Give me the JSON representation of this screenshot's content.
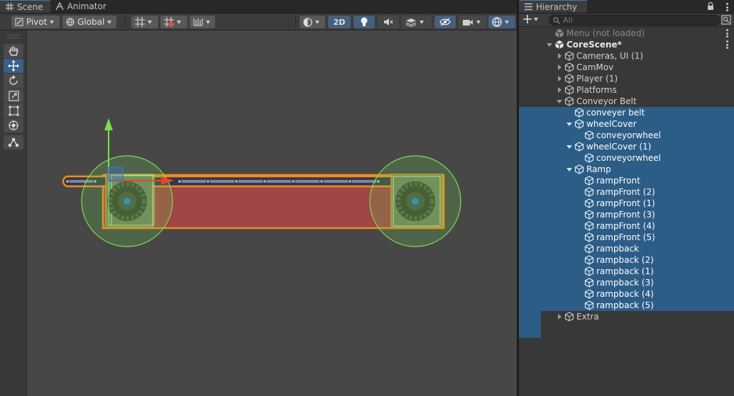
{
  "scene_tabs": [
    {
      "label": "Scene",
      "icon": "grid-icon",
      "active": true
    },
    {
      "label": "Animator",
      "icon": "animator-icon",
      "active": false
    }
  ],
  "scene_toolbar": {
    "pivot_label": "Pivot",
    "global_label": "Global",
    "mode_2d_label": "2D"
  },
  "tools": [
    "hand-tool",
    "move-tool",
    "rotate-tool",
    "scale-tool",
    "rect-tool",
    "transform-tool",
    "custom-editor-tool"
  ],
  "hierarchy": {
    "tab_label": "Hierarchy",
    "search_placeholder": "All",
    "rows": [
      {
        "label": "Menu (not loaded)",
        "depth": 0,
        "arrow": "none",
        "icon": "unity-scene-icon",
        "selected": false,
        "style": "dim"
      },
      {
        "label": "CoreScene*",
        "depth": 0,
        "arrow": "down",
        "icon": "unity-scene-icon",
        "selected": false,
        "style": "bold"
      },
      {
        "label": "Cameras, UI (1)",
        "depth": 1,
        "arrow": "right",
        "icon": "cube-icon",
        "selected": false
      },
      {
        "label": "CamMov",
        "depth": 1,
        "arrow": "right",
        "icon": "cube-icon",
        "selected": false
      },
      {
        "label": "Player (1)",
        "depth": 1,
        "arrow": "right",
        "icon": "cube-icon",
        "selected": false
      },
      {
        "label": "Platforms",
        "depth": 1,
        "arrow": "right",
        "icon": "cube-icon",
        "selected": false
      },
      {
        "label": "Conveyor Belt",
        "depth": 1,
        "arrow": "down",
        "icon": "cube-icon",
        "selected": false
      },
      {
        "label": "conveyer belt",
        "depth": 2,
        "arrow": "none",
        "icon": "cube-icon",
        "selected": true
      },
      {
        "label": "wheelCover",
        "depth": 2,
        "arrow": "down",
        "icon": "cube-icon",
        "selected": true
      },
      {
        "label": "conveyorwheel",
        "depth": 3,
        "arrow": "none",
        "icon": "cube-icon",
        "selected": true
      },
      {
        "label": "wheelCover (1)",
        "depth": 2,
        "arrow": "down",
        "icon": "cube-icon",
        "selected": true
      },
      {
        "label": "conveyorwheel",
        "depth": 3,
        "arrow": "none",
        "icon": "cube-icon",
        "selected": true
      },
      {
        "label": "Ramp",
        "depth": 2,
        "arrow": "down",
        "icon": "cube-icon",
        "selected": true
      },
      {
        "label": "rampFront",
        "depth": 3,
        "arrow": "none",
        "icon": "cube-icon",
        "selected": true
      },
      {
        "label": "rampFront (2)",
        "depth": 3,
        "arrow": "none",
        "icon": "cube-icon",
        "selected": true
      },
      {
        "label": "rampFront (1)",
        "depth": 3,
        "arrow": "none",
        "icon": "cube-icon",
        "selected": true
      },
      {
        "label": "rampFront (3)",
        "depth": 3,
        "arrow": "none",
        "icon": "cube-icon",
        "selected": true
      },
      {
        "label": "rampFront (4)",
        "depth": 3,
        "arrow": "none",
        "icon": "cube-icon",
        "selected": true
      },
      {
        "label": "rampFront (5)",
        "depth": 3,
        "arrow": "none",
        "icon": "cube-icon",
        "selected": true
      },
      {
        "label": "rampback",
        "depth": 3,
        "arrow": "none",
        "icon": "cube-icon",
        "selected": true
      },
      {
        "label": "rampback (2)",
        "depth": 3,
        "arrow": "none",
        "icon": "cube-icon",
        "selected": true
      },
      {
        "label": "rampback (1)",
        "depth": 3,
        "arrow": "none",
        "icon": "cube-icon",
        "selected": true
      },
      {
        "label": "rampback (3)",
        "depth": 3,
        "arrow": "none",
        "icon": "cube-icon",
        "selected": true
      },
      {
        "label": "rampback (4)",
        "depth": 3,
        "arrow": "none",
        "icon": "cube-icon",
        "selected": true
      },
      {
        "label": "rampback (5)",
        "depth": 3,
        "arrow": "none",
        "icon": "cube-icon",
        "selected": true
      },
      {
        "label": "Extra",
        "depth": 1,
        "arrow": "right",
        "icon": "cube-icon",
        "selected": false
      }
    ]
  },
  "colors": {
    "selection": "#2c5d87",
    "selection_outline": "#f08c1e",
    "belt_fill": "#a04646",
    "gizmo_green": "#7ce04a",
    "gizmo_red": "#e8452a",
    "viewport_bg": "#474747"
  }
}
